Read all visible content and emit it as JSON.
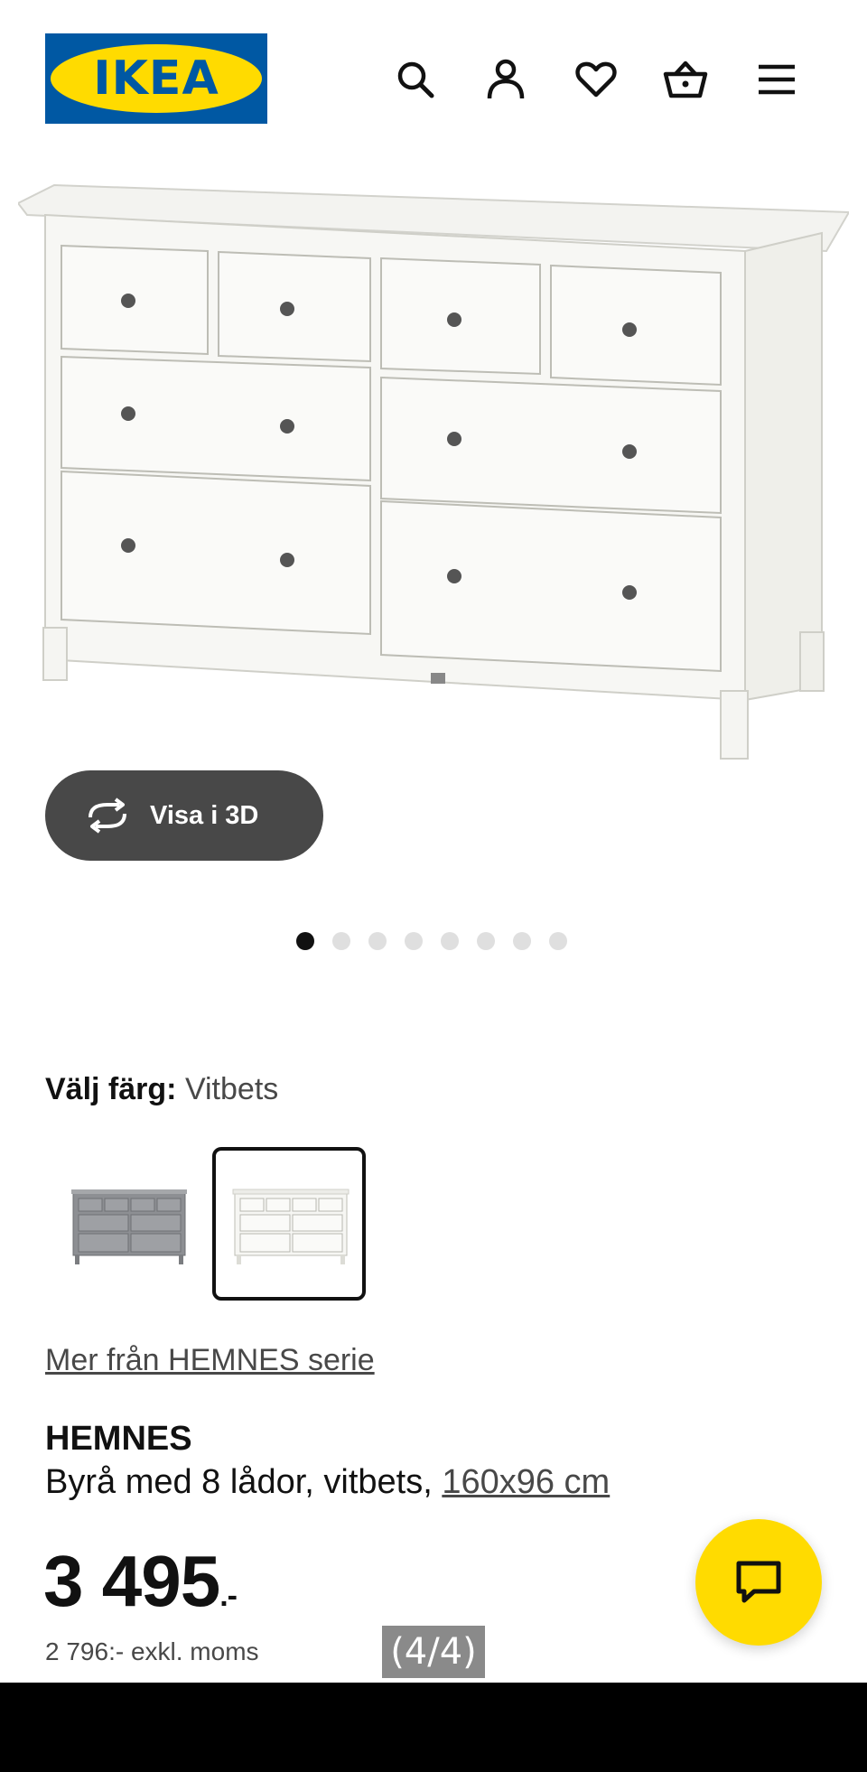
{
  "header": {
    "logo_text": "IKEA",
    "icons": [
      "search-icon",
      "user-icon",
      "heart-icon",
      "basket-icon",
      "menu-icon"
    ]
  },
  "view3d": {
    "label": "Visa i 3D",
    "icon": "rotate-icon"
  },
  "carousel": {
    "count": 8,
    "active_index": 0
  },
  "color": {
    "label": "Välj färg:",
    "value": "Vitbets",
    "swatches": [
      "gray-dresser-swatch",
      "white-dresser-swatch"
    ],
    "selected": 1
  },
  "series_link": "Mer från HEMNES serie",
  "product": {
    "name": "HEMNES",
    "description": "Byrå med 8 lådor, vitbets,",
    "dimensions": "160x96 cm"
  },
  "price": {
    "main": "3 495",
    "suffix": ".-",
    "excl_vat": "2 796:- exkl. moms"
  },
  "page_indicator": "(4/4)",
  "colors": {
    "ikea_blue": "#0058a3",
    "ikea_yellow": "#ffdb00",
    "button_dark": "#484848"
  }
}
